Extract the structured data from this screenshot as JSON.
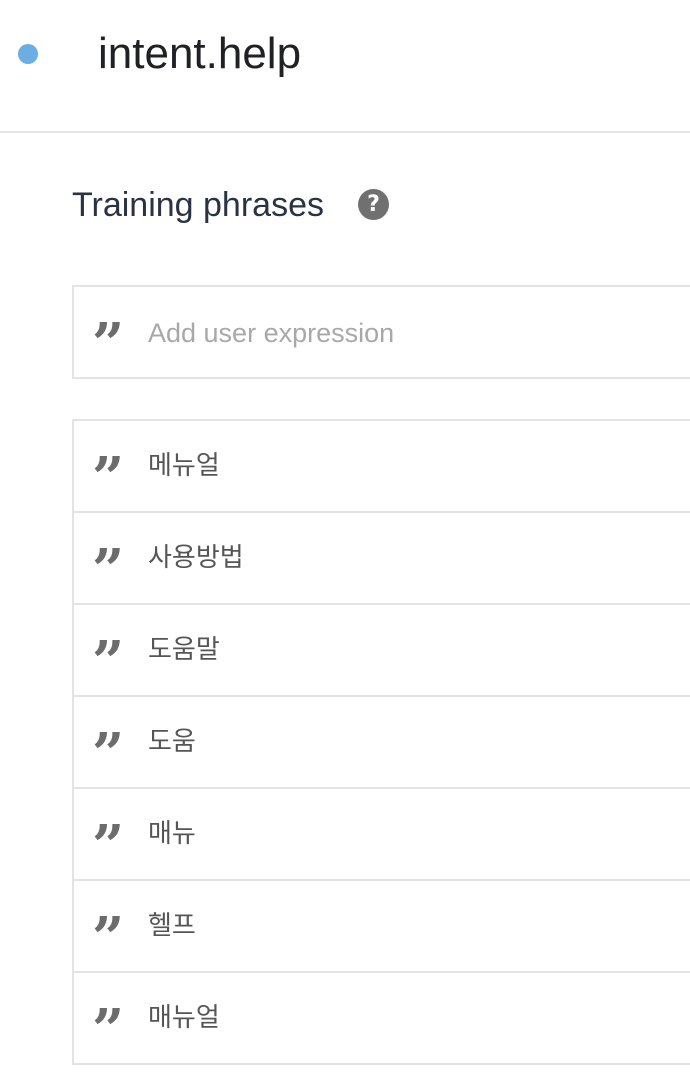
{
  "intent": {
    "name": "intent.help",
    "status_color": "#6aaee3"
  },
  "training": {
    "section_title": "Training phrases",
    "help_icon": "question-circle-icon",
    "add_placeholder": "Add user expression",
    "quote_icon": "quote-icon",
    "phrases": [
      {
        "text": "메뉴얼"
      },
      {
        "text": "사용방법"
      },
      {
        "text": "도움말"
      },
      {
        "text": "도움"
      },
      {
        "text": "매뉴"
      },
      {
        "text": "헬프"
      },
      {
        "text": "매뉴얼"
      }
    ]
  }
}
